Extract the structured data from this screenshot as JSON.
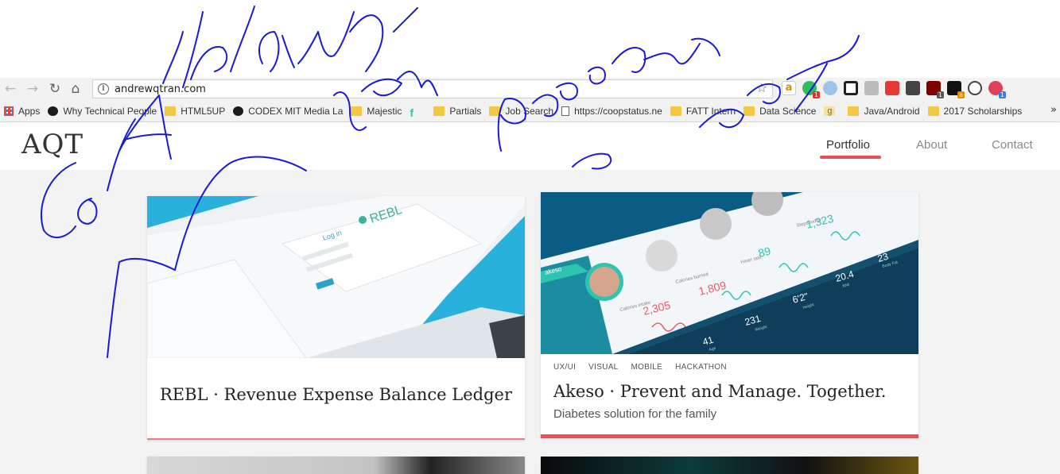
{
  "browser": {
    "url": "andrewqtran.com",
    "extension_icons": [
      "amazon-icon",
      "evernote-icon",
      "ai-icon",
      "pocket-icon",
      "rss-icon",
      "youtube-icon",
      "lightbulb-icon",
      "ublock-icon",
      "amazon-assistant-icon",
      "sync-icon",
      "ext-t-icon"
    ],
    "bookmarks": [
      {
        "label": "Apps",
        "icon": "apps-grid-icon"
      },
      {
        "label": "Why Technical People",
        "icon": "bookmark-favicon-icon"
      },
      {
        "label": "HTML5UP",
        "icon": "folder-icon"
      },
      {
        "label": "CODEX MIT Media La",
        "icon": "bookmark-favicon-icon"
      },
      {
        "label": "Majestic",
        "icon": "folder-icon"
      },
      {
        "label": "",
        "icon": "f-favicon-icon"
      },
      {
        "label": "Partials",
        "icon": "folder-icon"
      },
      {
        "label": "Job Search",
        "icon": "folder-icon"
      },
      {
        "label": "https://coopstatus.ne",
        "icon": "page-icon"
      },
      {
        "label": "FATT Intern",
        "icon": "folder-icon"
      },
      {
        "label": "Data Science",
        "icon": "folder-icon"
      },
      {
        "label": "",
        "icon": "g-favicon-icon"
      },
      {
        "label": "Java/Android",
        "icon": "folder-icon"
      },
      {
        "label": "2017 Scholarships",
        "icon": "folder-icon"
      }
    ],
    "more": "»"
  },
  "site": {
    "logo": "AQT",
    "nav": [
      "Portfolio",
      "About",
      "Contact"
    ],
    "accent": "#ef4d56"
  },
  "cards": [
    {
      "title": "REBL · Revenue Expense Balance Ledger",
      "image_text": {
        "brand": "REBL",
        "heading": "Log in"
      }
    },
    {
      "tags": [
        "UX/UI",
        "VISUAL",
        "MOBILE",
        "HACKATHON"
      ],
      "title": "Akeso · Prevent and Manage. Together.",
      "subtitle": "Diabetes solution for the family",
      "image_text": {
        "app": "akeso",
        "cal_in_label": "Calories intake",
        "cal_in": "2,305",
        "cal_burn_label": "Calories burned",
        "cal_burn": "1,809",
        "heart_label": "Heart rate",
        "heart": "89",
        "steps_label": "Steps today",
        "steps": "1,323",
        "age": "41",
        "age_label": "Age",
        "weight": "231",
        "weight_label": "Weight",
        "height": "6'2\"",
        "height_label": "Height",
        "bmi": "20.4",
        "bmi_label": "BMI",
        "bodyfat": "23",
        "bodyfat_label": "Body Fat"
      }
    }
  ]
}
